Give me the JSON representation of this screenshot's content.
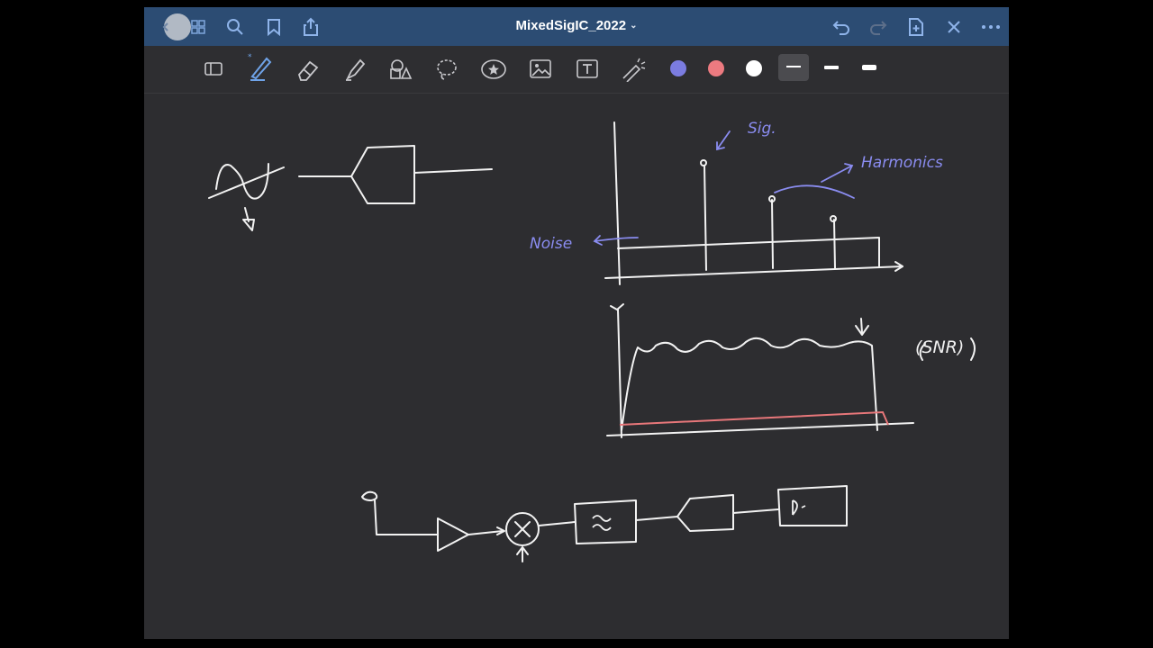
{
  "document": {
    "title": "MixedSigIC_2022"
  },
  "topbar": {
    "left_icons": [
      "back-indicator-icon",
      "grid-icon",
      "search-icon",
      "bookmark-icon",
      "share-icon"
    ],
    "right_icons": [
      "undo-icon",
      "redo-icon",
      "add-page-icon",
      "close-icon",
      "more-icon"
    ]
  },
  "toolbar": {
    "tools": [
      "reader-icon",
      "pen-icon",
      "eraser-icon",
      "highlighter-icon",
      "shapes-icon",
      "lasso-icon",
      "sticker-icon",
      "image-icon",
      "text-icon",
      "laser-icon"
    ],
    "colors": [
      "#7b7ce0",
      "#ec7a80",
      "#ffffff"
    ],
    "stroke_widths": [
      "thin",
      "medium",
      "thick"
    ],
    "selected_color": "#7b7ce0",
    "selected_stroke": "thin"
  },
  "canvas": {
    "annotations": {
      "sig": "Sig.",
      "harmonics": "Harmonics",
      "noise": "Noise",
      "snr": "(SNR)"
    }
  }
}
